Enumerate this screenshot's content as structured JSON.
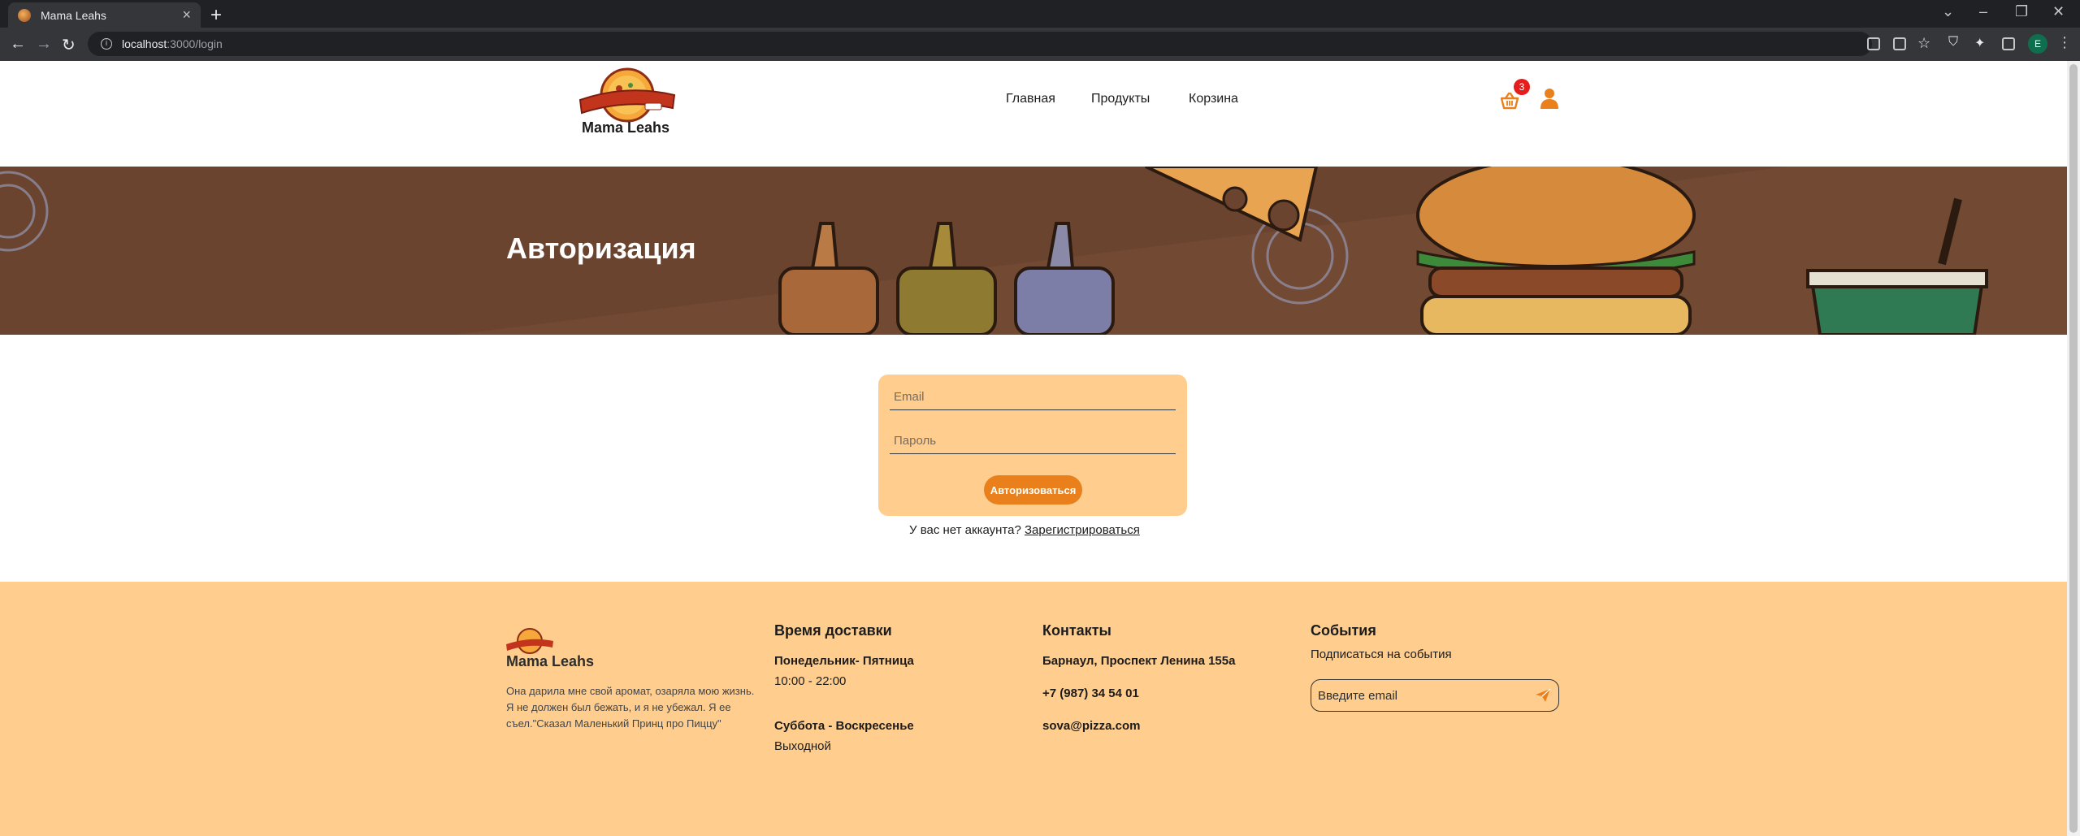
{
  "browser": {
    "tab_title": "Mama Leahs",
    "url_host": "localhost",
    "url_path": ":3000/login",
    "profile_initial": "E"
  },
  "header": {
    "brand": "Mama Leahs",
    "nav": [
      "Главная",
      "Продукты",
      "Корзина"
    ],
    "cart_count": "3"
  },
  "banner": {
    "title": "Авторизация"
  },
  "login": {
    "email_placeholder": "Email",
    "password_placeholder": "Пароль",
    "submit_label": "Авторизоваться",
    "register_prompt": "У вас нет аккаунта?",
    "register_link": "Зарегистрироваться"
  },
  "footer": {
    "brand": "Mama Leahs",
    "about": "Она дарила мне свой аромат, озаряла мою жизнь. Я не должен был бежать, и я не убежал. Я ее съел.\"Сказал Маленький Принц про Пиццу\"",
    "delivery": {
      "heading": "Время доставки",
      "weekdays": "Понедельник- Пятница",
      "weekday_hours": "10:00 - 22:00",
      "weekend": "Суббота - Воскресенье",
      "weekend_hours": "Выходной"
    },
    "contacts": {
      "heading": "Контакты",
      "address": "Барнаул, Проспект Ленина 155а",
      "phone": "+7 (987) 34 54 01",
      "email": "sova@pizza.com"
    },
    "events": {
      "heading": "События",
      "subtitle": "Подписаться на события",
      "email_placeholder": "Введите email"
    }
  },
  "colors": {
    "accent": "#e9801c",
    "form_bg": "#ffcd8e",
    "banner_bg": "#6b4430",
    "badge": "#e51d1d"
  }
}
